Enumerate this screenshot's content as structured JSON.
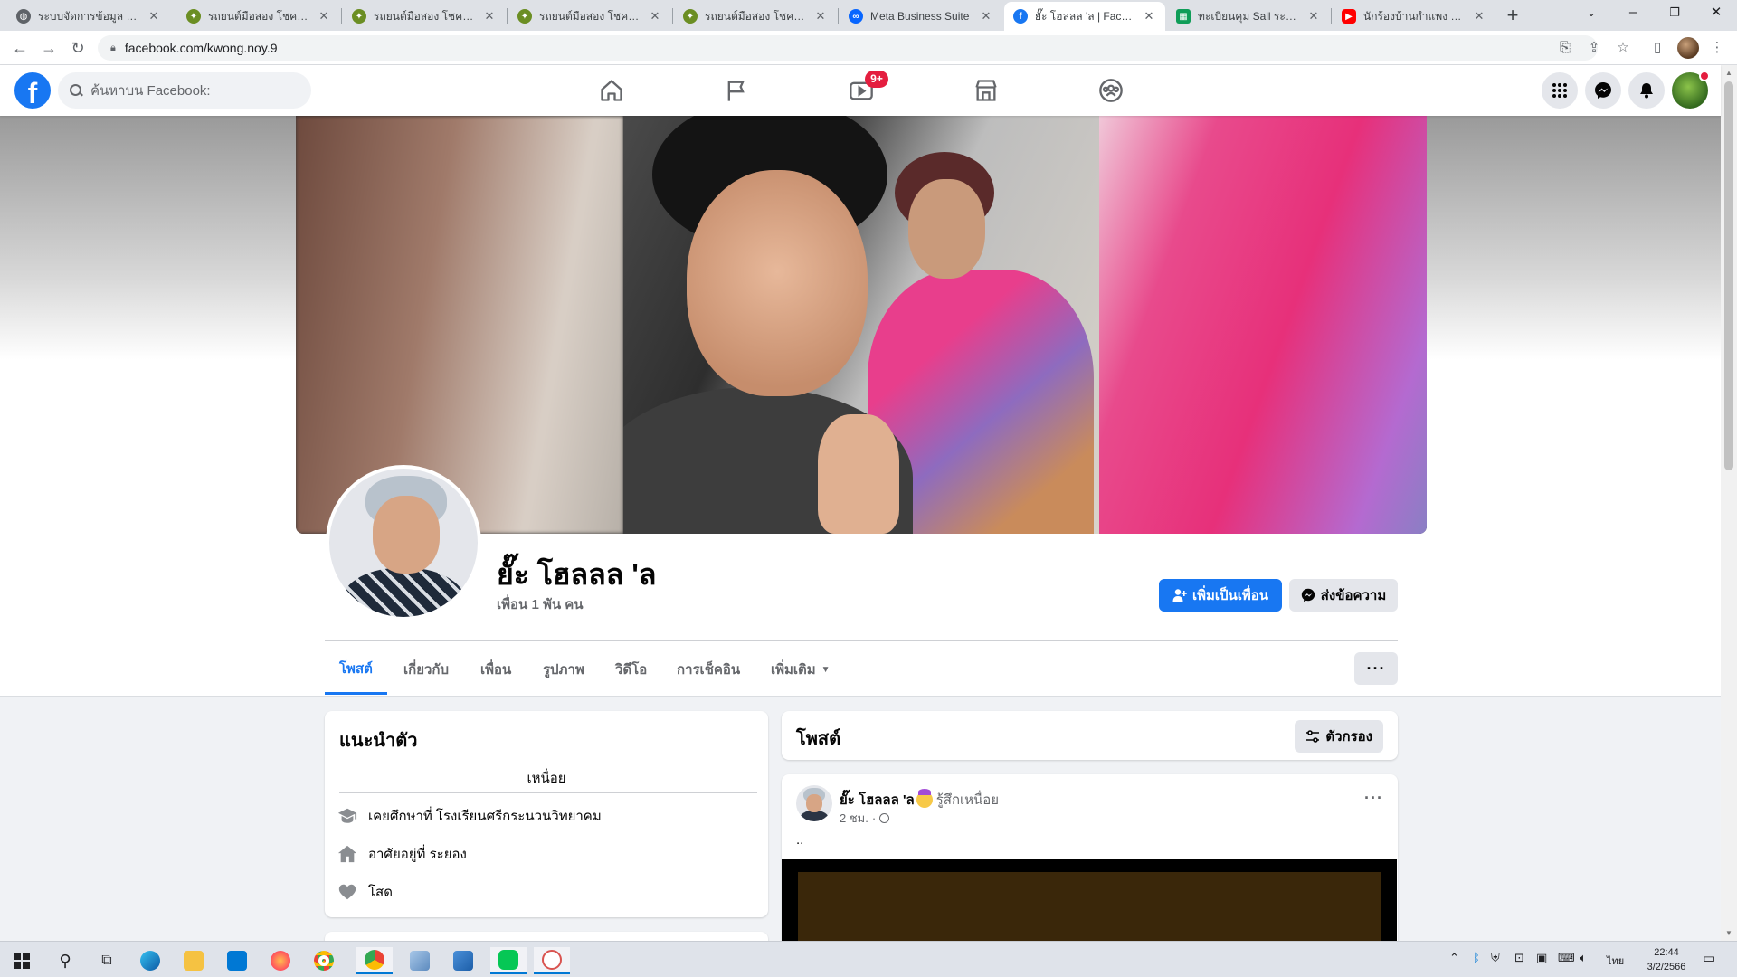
{
  "browser": {
    "tabs": [
      {
        "title": "ระบบจัดการข้อมูล บริษัท",
        "favicon": "globe-icon",
        "color": "#5f6368"
      },
      {
        "title": "รถยนต์มือสอง โชคลูกโ",
        "favicon": "car-logo-icon",
        "color": "#6b8e23"
      },
      {
        "title": "รถยนต์มือสอง โชคลูกโ",
        "favicon": "car-logo-icon",
        "color": "#6b8e23"
      },
      {
        "title": "รถยนต์มือสอง โชคลูกโ",
        "favicon": "car-logo-icon",
        "color": "#6b8e23"
      },
      {
        "title": "รถยนต์มือสอง โชคลูกโ",
        "favicon": "car-logo-icon",
        "color": "#6b8e23"
      },
      {
        "title": "Meta Business Suite",
        "favicon": "meta-icon",
        "color": "#0866ff"
      },
      {
        "title": "ยั๊ะ โฮลลล 'ล | Facebook",
        "favicon": "facebook-icon",
        "color": "#1877f2"
      },
      {
        "title": "ทะเบียนคุม Sall ระบบออน",
        "favicon": "sheets-icon",
        "color": "#0f9d58"
      },
      {
        "title": "นักร้องบ้านกำแพง ล่าสุด",
        "favicon": "youtube-icon",
        "color": "#ff0000"
      }
    ],
    "active_tab": 6,
    "url": "facebook.com/kwong.noy.9"
  },
  "facebook": {
    "search_placeholder": "ค้นหาบน Facebook:",
    "watch_badge": "9+",
    "brand_color": "#1877f2"
  },
  "profile": {
    "name": "ยั๊ะ โฮลลล 'ล",
    "friends": "เพื่อน 1 พัน คน",
    "add_friend_label": "เพิ่มเป็นเพื่อน",
    "message_label": "ส่งข้อความ",
    "tabs": [
      "โพสต์",
      "เกี่ยวกับ",
      "เพื่อน",
      "รูปภาพ",
      "วิดีโอ",
      "การเช็คอิน",
      "เพิ่มเติม"
    ],
    "active_tab": 0
  },
  "intro": {
    "title": "แนะนำตัว",
    "bio": "เหนื่อย",
    "items": [
      {
        "icon": "graduation-cap-icon",
        "text": "เคยศึกษาที่ โรงเรียนศรีกระนวนวิทยาคม"
      },
      {
        "icon": "home-icon",
        "text": "อาศัยอยู่ที่ ระยอง"
      },
      {
        "icon": "heart-icon",
        "text": "โสด"
      }
    ]
  },
  "posts": {
    "title": "โพสต์",
    "filter_label": "ตัวกรอง",
    "items": [
      {
        "author": "ยั๊ะ โฮลลล 'ล",
        "feeling": "รู้สึกเหนื่อย",
        "time": "2 ชม.",
        "audience": "public-globe-icon",
        "text": ".."
      }
    ]
  },
  "taskbar": {
    "apps": [
      "windows-start-icon",
      "search-icon",
      "task-view-icon",
      "edge-icon",
      "file-explorer-icon",
      "mail-icon",
      "firefox-icon",
      "chrome-icon",
      "chrome-profile-icon",
      "app-icon",
      "photos-icon",
      "line-icon",
      "paint-icon"
    ],
    "language": "ไทย",
    "time": "22:44",
    "date": "3/2/2566"
  }
}
